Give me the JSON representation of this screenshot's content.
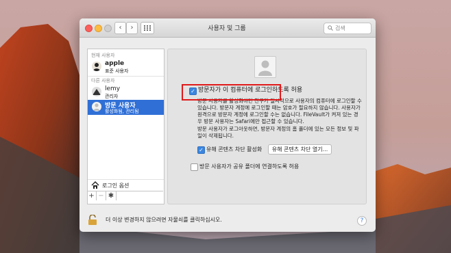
{
  "window": {
    "title": "사용자 및 그룹",
    "search_placeholder": "검색",
    "nav_back": "‹",
    "nav_forward": "›",
    "grid_icon": "grid-icon"
  },
  "sidebar": {
    "current_user_label": "현재 사용자",
    "other_users_label": "다른 사용자",
    "users": [
      {
        "name": "apple",
        "role": "표준 사용자"
      },
      {
        "name": "lemy",
        "role": "관리자"
      },
      {
        "name": "방문 사용자",
        "role": "활성화됨, 관리됨"
      }
    ],
    "login_options": "로그인 옵션",
    "add_label": "+",
    "remove_label": "−",
    "gear_label": "✱"
  },
  "panel": {
    "allow_guest_label": "방문자가 이 컴퓨터에 로그인하도록 허용",
    "description": "방문 사용자를 활성화하면 친구가 일시적으로 사용자의 컴퓨터에 로그인할 수 있습니다. 방문자 계정에 로그인할 때는 암호가 필요하지 않습니다. 사용자가 원격으로 방문자 계정에 로그인할 수는 없습니다. FileVault가 켜져 있는 경우 방문 사용자는 Safari에만 접근할 수 있습니다.",
    "logout_note": "방문 사용자가 로그아웃하면, 방문자 계정의 홈 폴더에 있는 모든 정보 및 파일이 삭제됩니다.",
    "parental_label": "유해 콘텐츠 차단 활성화",
    "parental_button": "유해 콘텐츠 차단 열기...",
    "shared_folders_label": "방문 사용자가 공유 폴더에 연결하도록 허용"
  },
  "footer": {
    "lock_text": "더 이상 변경하지 않으려면 자물쇠를 클릭하십시오.",
    "help_label": "?"
  },
  "colors": {
    "accent": "#3b86e0",
    "selection": "#2f6fd6",
    "highlight_box": "#e01818"
  }
}
